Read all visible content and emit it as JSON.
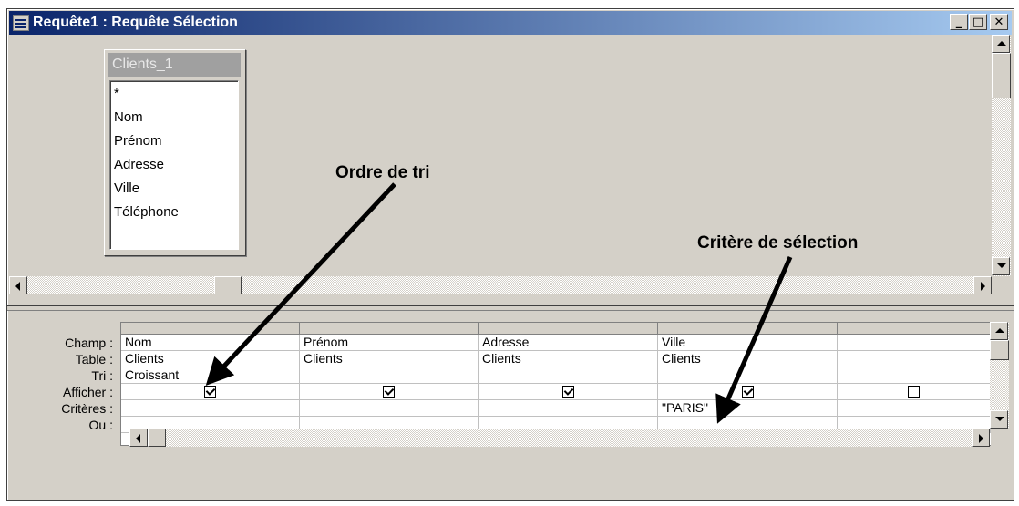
{
  "window": {
    "title": "Requête1 : Requête Sélection",
    "min_label": "_",
    "max_label": "□",
    "close_label": "✕"
  },
  "field_list": {
    "title": "Clients_1",
    "fields": [
      "*",
      "Nom",
      "Prénom",
      "Adresse",
      "Ville",
      "Téléphone"
    ]
  },
  "grid": {
    "row_labels": [
      "Champ :",
      "Table :",
      "Tri :",
      "Afficher :",
      "Critères :",
      "Ou :"
    ],
    "columns": [
      {
        "champ": "Nom",
        "table": "Clients",
        "tri": "Croissant",
        "afficher": true,
        "criteres": "",
        "ou": ""
      },
      {
        "champ": "Prénom",
        "table": "Clients",
        "tri": "",
        "afficher": true,
        "criteres": "",
        "ou": ""
      },
      {
        "champ": "Adresse",
        "table": "Clients",
        "tri": "",
        "afficher": true,
        "criteres": "",
        "ou": ""
      },
      {
        "champ": "Ville",
        "table": "Clients",
        "tri": "",
        "afficher": true,
        "criteres": "\"PARIS\"",
        "ou": ""
      },
      {
        "champ": "",
        "table": "",
        "tri": "",
        "afficher": false,
        "criteres": "",
        "ou": ""
      }
    ]
  },
  "annotations": {
    "sort_order": "Ordre de tri",
    "selection_criteria": "Critère de sélection"
  }
}
